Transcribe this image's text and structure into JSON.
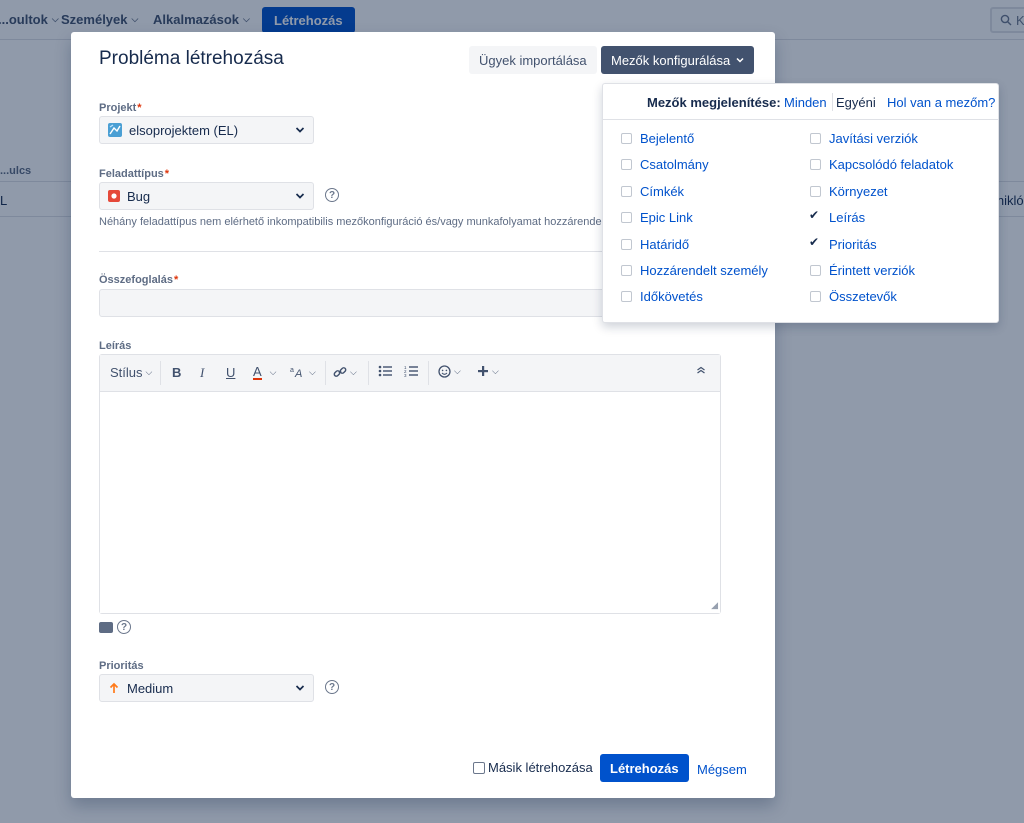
{
  "nav": {
    "items": [
      "...oultok",
      "Személyek",
      "Alkalmazások"
    ],
    "create_label": "Létrehozás",
    "search_text": "K"
  },
  "background": {
    "column_header": "...ulcs",
    "row_key": "L",
    "row_right": "...nikló"
  },
  "modal": {
    "title": "Probléma létrehozása",
    "import_button": "Ügyek importálása",
    "configure_button": "Mezők konfigurálása",
    "project": {
      "label": "Projekt",
      "value": "elsoprojektem (EL)"
    },
    "issue_type": {
      "label": "Feladattípus",
      "value": "Bug",
      "hint": "Néhány feladattípus nem elérhető inkompatibilis mezőkonfiguráció és/vagy munkafolyamat hozzárendel..."
    },
    "summary": {
      "label": "Összefoglalás",
      "value": ""
    },
    "description": {
      "label": "Leírás",
      "toolbar": {
        "style": "Stílus",
        "bold": "B",
        "italic": "I",
        "underline": "U",
        "color": "A"
      }
    },
    "priority": {
      "label": "Prioritás",
      "value": "Medium"
    },
    "footer": {
      "create_another": "Másik létrehozása",
      "create_button": "Létrehozás",
      "cancel": "Mégsem"
    }
  },
  "fields_dropdown": {
    "label": "Mezők megjelenítése:",
    "all": "Minden",
    "custom": "Egyéni",
    "where_field": "Hol van a mezőm?",
    "left_items": [
      {
        "label": "Bejelentő",
        "checked": false
      },
      {
        "label": "Csatolmány",
        "checked": false
      },
      {
        "label": "Címkék",
        "checked": false
      },
      {
        "label": "Epic Link",
        "checked": false
      },
      {
        "label": "Határidő",
        "checked": false
      },
      {
        "label": "Hozzárendelt személy",
        "checked": false
      },
      {
        "label": "Időkövetés",
        "checked": false
      }
    ],
    "right_items": [
      {
        "label": "Javítási verziók",
        "checked": false
      },
      {
        "label": "Kapcsolódó feladatok",
        "checked": false
      },
      {
        "label": "Környezet",
        "checked": false
      },
      {
        "label": "Leírás",
        "checked": true
      },
      {
        "label": "Prioritás",
        "checked": true
      },
      {
        "label": "Érintett verziók",
        "checked": false
      },
      {
        "label": "Összetevők",
        "checked": false
      }
    ]
  },
  "colors": {
    "primary": "#0052cc",
    "dark_button": "#42526e",
    "required": "#de350b",
    "bug": "#e5493a",
    "priority_medium": "#ff7a1a"
  }
}
